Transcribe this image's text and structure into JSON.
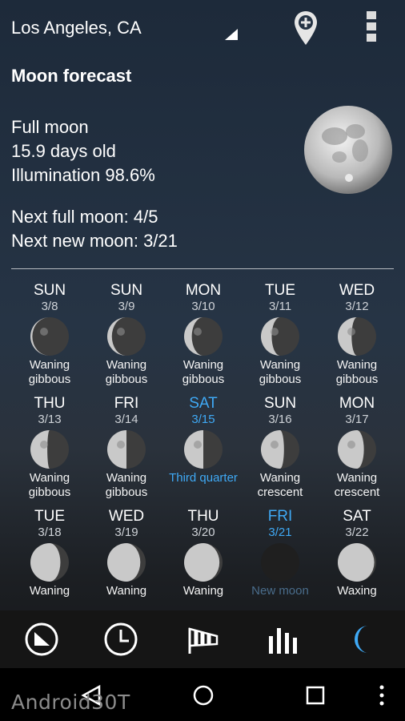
{
  "header": {
    "location": "Los Angeles, CA",
    "icons": [
      "dropdown-icon",
      "add-location-icon",
      "overflow-menu-icon"
    ]
  },
  "panel": {
    "title": "Moon forecast",
    "phase": "Full moon",
    "age": "15.9 days old",
    "illumination": "Illumination 98.6%",
    "next_full": "Next full moon: 4/5",
    "next_new": "Next new moon: 3/21"
  },
  "forecast": [
    {
      "day": "SUN",
      "date": "3/8",
      "phase": "Waning gibbous"
    },
    {
      "day": "SUN",
      "date": "3/9",
      "phase": "Waning gibbous"
    },
    {
      "day": "MON",
      "date": "3/10",
      "phase": "Waning gibbous"
    },
    {
      "day": "TUE",
      "date": "3/11",
      "phase": "Waning gibbous"
    },
    {
      "day": "WED",
      "date": "3/12",
      "phase": "Waning gibbous"
    },
    {
      "day": "THU",
      "date": "3/13",
      "phase": "Waning gibbous"
    },
    {
      "day": "FRI",
      "date": "3/14",
      "phase": "Waning gibbous"
    },
    {
      "day": "SAT",
      "date": "3/15",
      "phase": "Third quarter"
    },
    {
      "day": "SUN",
      "date": "3/16",
      "phase": "Waning crescent"
    },
    {
      "day": "MON",
      "date": "3/17",
      "phase": "Waning crescent"
    },
    {
      "day": "TUE",
      "date": "3/18",
      "phase": "Waning"
    },
    {
      "day": "WED",
      "date": "3/19",
      "phase": "Waning"
    },
    {
      "day": "THU",
      "date": "3/20",
      "phase": "Waning"
    },
    {
      "day": "FRI",
      "date": "3/21",
      "phase": "New moon"
    },
    {
      "day": "SAT",
      "date": "3/22",
      "phase": "Waxing"
    }
  ],
  "bottom_nav": [
    "current-conditions-icon",
    "hourly-clock-icon",
    "wind-sock-icon",
    "bar-chart-icon",
    "moon-icon"
  ],
  "system_nav": [
    "back-icon",
    "home-icon",
    "recents-icon",
    "more-icon"
  ],
  "watermark": "Android30T",
  "colors": {
    "accent": "#3fa9f5",
    "text": "#ffffff"
  }
}
